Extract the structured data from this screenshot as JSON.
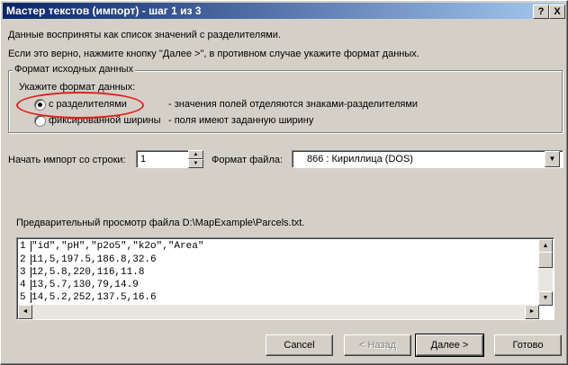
{
  "window": {
    "title": "Мастер текстов (импорт) - шаг 1 из 3",
    "help_label": "?",
    "close_label": "X"
  },
  "intro": {
    "line1": "Данные восприняты как список значений с разделителями.",
    "line2": "Если это верно, нажмите кнопку \"Далее >\", в противном случае укажите формат данных."
  },
  "format_group": {
    "label": "Формат исходных данных",
    "prompt": "Укажите формат данных:",
    "options": [
      {
        "label": "с разделителями",
        "description": "- значения полей отделяются знаками-разделителями",
        "selected": true
      },
      {
        "label": "фиксированной ширины",
        "description": "- поля имеют заданную ширину",
        "selected": false
      }
    ]
  },
  "import_start": {
    "label": "Начать импорт со строки:",
    "value": "1"
  },
  "file_format": {
    "label": "Формат файла:",
    "value": "866 : Кириллица (DOS)"
  },
  "preview": {
    "title": "Предварительный просмотр файла D:\\MapExample\\Parcels.txt.",
    "rows": [
      {
        "num": "1",
        "text": "\"id\",\"pH\",\"p2o5\",\"k2o\",\"Area\""
      },
      {
        "num": "2",
        "text": "11,5,197.5,186.8,32.6"
      },
      {
        "num": "3",
        "text": "12,5.8,220,116,11.8"
      },
      {
        "num": "4",
        "text": "13,5.7,130,79,14.9"
      },
      {
        "num": "5",
        "text": "14,5.2,252,137.5,16.6"
      }
    ]
  },
  "buttons": {
    "cancel": "Cancel",
    "back": "< Назад",
    "next": "Далее >",
    "finish": "Готово"
  },
  "colors": {
    "annotation_ellipse": "#e0201a",
    "titlebar_start": "#0a246a",
    "titlebar_end": "#a6caf0"
  }
}
